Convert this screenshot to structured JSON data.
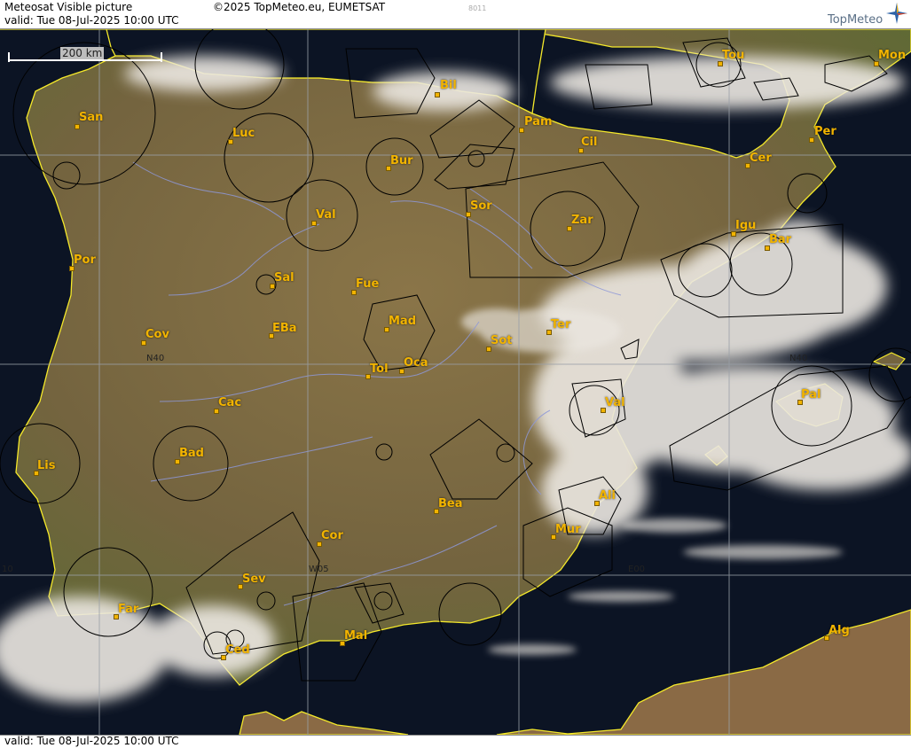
{
  "header": {
    "title": "Meteosat Visible picture",
    "copyright": "©2025 TopMeteo.eu, EUMETSAT",
    "valid": "valid:  Tue  08-Jul-2025  10:00 UTC",
    "code": "8011",
    "brand": "TopMeteo"
  },
  "footer": {
    "valid": "valid:  Tue  08-Jul-2025  10:00 UTC"
  },
  "scale": {
    "label": "200 km"
  },
  "grid_labels": {
    "n40_west": "N40",
    "n40_east": "N40",
    "w05": "W05",
    "e00": "E00",
    "w10": "10"
  },
  "cities": [
    {
      "id": "san",
      "label": "San"
    },
    {
      "id": "luc",
      "label": "Luc"
    },
    {
      "id": "bil",
      "label": "Bil"
    },
    {
      "id": "tou",
      "label": "Tou"
    },
    {
      "id": "mon",
      "label": "Mon"
    },
    {
      "id": "pam",
      "label": "Pam"
    },
    {
      "id": "per",
      "label": "Per"
    },
    {
      "id": "cil",
      "label": "Cil"
    },
    {
      "id": "bur",
      "label": "Bur"
    },
    {
      "id": "cer",
      "label": "Cer"
    },
    {
      "id": "val1",
      "label": "Val"
    },
    {
      "id": "sor",
      "label": "Sor"
    },
    {
      "id": "zar",
      "label": "Zar"
    },
    {
      "id": "igu",
      "label": "Igu"
    },
    {
      "id": "bar",
      "label": "Bar"
    },
    {
      "id": "por",
      "label": "Por"
    },
    {
      "id": "sal",
      "label": "Sal"
    },
    {
      "id": "fue",
      "label": "Fue"
    },
    {
      "id": "mad",
      "label": "Mad"
    },
    {
      "id": "ter",
      "label": "Ter"
    },
    {
      "id": "cov",
      "label": "Cov"
    },
    {
      "id": "eba",
      "label": "EBa"
    },
    {
      "id": "sot",
      "label": "Sot"
    },
    {
      "id": "tol",
      "label": "Tol"
    },
    {
      "id": "oca",
      "label": "Oca"
    },
    {
      "id": "pal",
      "label": "Pal"
    },
    {
      "id": "cac",
      "label": "Cac"
    },
    {
      "id": "val2",
      "label": "Val"
    },
    {
      "id": "bad",
      "label": "Bad"
    },
    {
      "id": "lis",
      "label": "Lis"
    },
    {
      "id": "ali",
      "label": "Ali"
    },
    {
      "id": "bea",
      "label": "Bea"
    },
    {
      "id": "mur",
      "label": "Mur"
    },
    {
      "id": "cor",
      "label": "Cor"
    },
    {
      "id": "sev",
      "label": "Sev"
    },
    {
      "id": "far",
      "label": "Far"
    },
    {
      "id": "mal",
      "label": "Mal"
    },
    {
      "id": "ced",
      "label": "Ced"
    },
    {
      "id": "alg",
      "label": "Alg"
    }
  ],
  "colors": {
    "land": "#7b6a44",
    "sea": "#0c1424",
    "coast": "#f5e92a",
    "cloud": "#ece8e2",
    "label": "#f2b400"
  }
}
